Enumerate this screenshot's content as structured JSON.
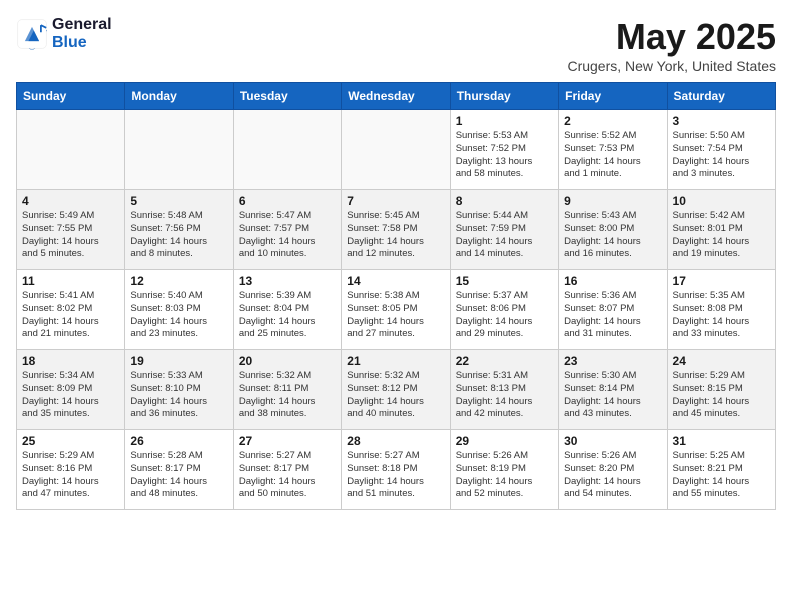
{
  "header": {
    "logo_line1": "General",
    "logo_line2": "Blue",
    "title": "May 2025",
    "subtitle": "Crugers, New York, United States"
  },
  "days_of_week": [
    "Sunday",
    "Monday",
    "Tuesday",
    "Wednesday",
    "Thursday",
    "Friday",
    "Saturday"
  ],
  "weeks": [
    [
      {
        "num": "",
        "info": "",
        "empty": true
      },
      {
        "num": "",
        "info": "",
        "empty": true
      },
      {
        "num": "",
        "info": "",
        "empty": true
      },
      {
        "num": "",
        "info": "",
        "empty": true
      },
      {
        "num": "1",
        "info": "Sunrise: 5:53 AM\nSunset: 7:52 PM\nDaylight: 13 hours\nand 58 minutes."
      },
      {
        "num": "2",
        "info": "Sunrise: 5:52 AM\nSunset: 7:53 PM\nDaylight: 14 hours\nand 1 minute."
      },
      {
        "num": "3",
        "info": "Sunrise: 5:50 AM\nSunset: 7:54 PM\nDaylight: 14 hours\nand 3 minutes."
      }
    ],
    [
      {
        "num": "4",
        "info": "Sunrise: 5:49 AM\nSunset: 7:55 PM\nDaylight: 14 hours\nand 5 minutes."
      },
      {
        "num": "5",
        "info": "Sunrise: 5:48 AM\nSunset: 7:56 PM\nDaylight: 14 hours\nand 8 minutes."
      },
      {
        "num": "6",
        "info": "Sunrise: 5:47 AM\nSunset: 7:57 PM\nDaylight: 14 hours\nand 10 minutes."
      },
      {
        "num": "7",
        "info": "Sunrise: 5:45 AM\nSunset: 7:58 PM\nDaylight: 14 hours\nand 12 minutes."
      },
      {
        "num": "8",
        "info": "Sunrise: 5:44 AM\nSunset: 7:59 PM\nDaylight: 14 hours\nand 14 minutes."
      },
      {
        "num": "9",
        "info": "Sunrise: 5:43 AM\nSunset: 8:00 PM\nDaylight: 14 hours\nand 16 minutes."
      },
      {
        "num": "10",
        "info": "Sunrise: 5:42 AM\nSunset: 8:01 PM\nDaylight: 14 hours\nand 19 minutes."
      }
    ],
    [
      {
        "num": "11",
        "info": "Sunrise: 5:41 AM\nSunset: 8:02 PM\nDaylight: 14 hours\nand 21 minutes."
      },
      {
        "num": "12",
        "info": "Sunrise: 5:40 AM\nSunset: 8:03 PM\nDaylight: 14 hours\nand 23 minutes."
      },
      {
        "num": "13",
        "info": "Sunrise: 5:39 AM\nSunset: 8:04 PM\nDaylight: 14 hours\nand 25 minutes."
      },
      {
        "num": "14",
        "info": "Sunrise: 5:38 AM\nSunset: 8:05 PM\nDaylight: 14 hours\nand 27 minutes."
      },
      {
        "num": "15",
        "info": "Sunrise: 5:37 AM\nSunset: 8:06 PM\nDaylight: 14 hours\nand 29 minutes."
      },
      {
        "num": "16",
        "info": "Sunrise: 5:36 AM\nSunset: 8:07 PM\nDaylight: 14 hours\nand 31 minutes."
      },
      {
        "num": "17",
        "info": "Sunrise: 5:35 AM\nSunset: 8:08 PM\nDaylight: 14 hours\nand 33 minutes."
      }
    ],
    [
      {
        "num": "18",
        "info": "Sunrise: 5:34 AM\nSunset: 8:09 PM\nDaylight: 14 hours\nand 35 minutes."
      },
      {
        "num": "19",
        "info": "Sunrise: 5:33 AM\nSunset: 8:10 PM\nDaylight: 14 hours\nand 36 minutes."
      },
      {
        "num": "20",
        "info": "Sunrise: 5:32 AM\nSunset: 8:11 PM\nDaylight: 14 hours\nand 38 minutes."
      },
      {
        "num": "21",
        "info": "Sunrise: 5:32 AM\nSunset: 8:12 PM\nDaylight: 14 hours\nand 40 minutes."
      },
      {
        "num": "22",
        "info": "Sunrise: 5:31 AM\nSunset: 8:13 PM\nDaylight: 14 hours\nand 42 minutes."
      },
      {
        "num": "23",
        "info": "Sunrise: 5:30 AM\nSunset: 8:14 PM\nDaylight: 14 hours\nand 43 minutes."
      },
      {
        "num": "24",
        "info": "Sunrise: 5:29 AM\nSunset: 8:15 PM\nDaylight: 14 hours\nand 45 minutes."
      }
    ],
    [
      {
        "num": "25",
        "info": "Sunrise: 5:29 AM\nSunset: 8:16 PM\nDaylight: 14 hours\nand 47 minutes."
      },
      {
        "num": "26",
        "info": "Sunrise: 5:28 AM\nSunset: 8:17 PM\nDaylight: 14 hours\nand 48 minutes."
      },
      {
        "num": "27",
        "info": "Sunrise: 5:27 AM\nSunset: 8:17 PM\nDaylight: 14 hours\nand 50 minutes."
      },
      {
        "num": "28",
        "info": "Sunrise: 5:27 AM\nSunset: 8:18 PM\nDaylight: 14 hours\nand 51 minutes."
      },
      {
        "num": "29",
        "info": "Sunrise: 5:26 AM\nSunset: 8:19 PM\nDaylight: 14 hours\nand 52 minutes."
      },
      {
        "num": "30",
        "info": "Sunrise: 5:26 AM\nSunset: 8:20 PM\nDaylight: 14 hours\nand 54 minutes."
      },
      {
        "num": "31",
        "info": "Sunrise: 5:25 AM\nSunset: 8:21 PM\nDaylight: 14 hours\nand 55 minutes."
      }
    ]
  ]
}
